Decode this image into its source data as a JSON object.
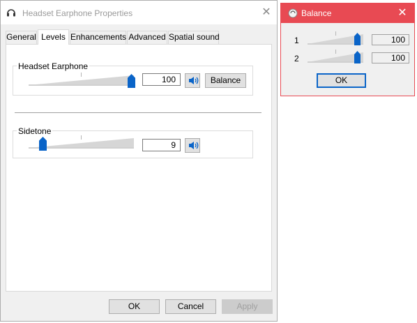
{
  "main": {
    "title": "Headset Earphone Properties",
    "close_glyph": "✕",
    "tabs": [
      {
        "label": "General"
      },
      {
        "label": "Levels"
      },
      {
        "label": "Enhancements"
      },
      {
        "label": "Advanced"
      },
      {
        "label": "Spatial sound"
      }
    ],
    "active_tab": "Levels",
    "headset_group": {
      "label": "Headset Earphone",
      "value": "100",
      "balance_label": "Balance"
    },
    "sidetone_group": {
      "label": "Sidetone",
      "value": "9"
    },
    "footer": {
      "ok_label": "OK",
      "cancel_label": "Cancel",
      "apply_label": "Apply"
    }
  },
  "balance": {
    "title": "Balance",
    "close_glyph": "✕",
    "channels": [
      {
        "label": "1",
        "value": "100"
      },
      {
        "label": "2",
        "value": "100"
      }
    ],
    "ok_label": "OK"
  },
  "levels": {
    "headset_slider": 1.0,
    "sidetone_slider": 0.09,
    "channel_1_slider": 1.0,
    "channel_2_slider": 1.0
  },
  "colors": {
    "accent": "#0a64c8",
    "balance_titlebar": "#e84a53",
    "window_bg": "#f0f0f0"
  },
  "icons": [
    "headset-icon",
    "speaker-icon",
    "balance-icon",
    "close-icon"
  ]
}
